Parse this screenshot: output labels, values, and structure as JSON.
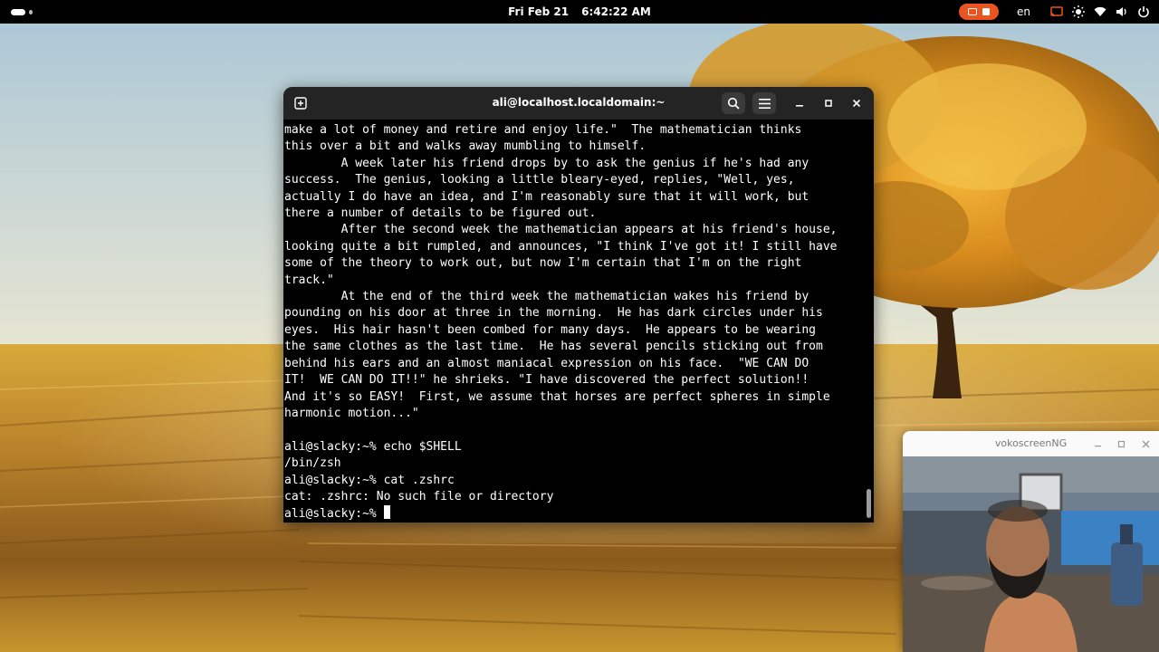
{
  "topbar": {
    "date": "Fri Feb 21",
    "time": "6:42:22 AM",
    "language": "en"
  },
  "terminal": {
    "title": "ali@localhost.localdomain:~",
    "lines": [
      "make a lot of money and retire and enjoy life.\"  The mathematician thinks",
      "this over a bit and walks away mumbling to himself.",
      "        A week later his friend drops by to ask the genius if he's had any",
      "success.  The genius, looking a little bleary-eyed, replies, \"Well, yes,",
      "actually I do have an idea, and I'm reasonably sure that it will work, but",
      "there a number of details to be figured out.",
      "        After the second week the mathematician appears at his friend's house,",
      "looking quite a bit rumpled, and announces, \"I think I've got it! I still have",
      "some of the theory to work out, but now I'm certain that I'm on the right",
      "track.\"",
      "        At the end of the third week the mathematician wakes his friend by",
      "pounding on his door at three in the morning.  He has dark circles under his",
      "eyes.  His hair hasn't been combed for many days.  He appears to be wearing",
      "the same clothes as the last time.  He has several pencils sticking out from",
      "behind his ears and an almost maniacal expression on his face.  \"WE CAN DO",
      "IT!  WE CAN DO IT!!\" he shrieks. \"I have discovered the perfect solution!!",
      "And it's so EASY!  First, we assume that horses are perfect spheres in simple",
      "harmonic motion...\"",
      "",
      "ali@slacky:~% echo $SHELL",
      "/bin/zsh",
      "ali@slacky:~% cat .zshrc",
      "cat: .zshrc: No such file or directory"
    ],
    "prompt": "ali@slacky:~% "
  },
  "camera_window": {
    "title": "vokoscreenNG"
  },
  "colors": {
    "topbar_bg": "#000000",
    "accent": "#e95420",
    "terminal_bg": "#000000",
    "terminal_header": "#242424"
  },
  "icons": {
    "new_tab": "new-tab-icon",
    "search": "search-icon",
    "menu": "hamburger-menu-icon",
    "minimize": "minimize-icon",
    "maximize": "maximize-icon",
    "close": "close-icon",
    "tray": [
      "screen-record-icon",
      "stop-icon",
      "cast-icon",
      "brightness-icon",
      "wifi-icon",
      "volume-icon",
      "power-icon"
    ]
  }
}
